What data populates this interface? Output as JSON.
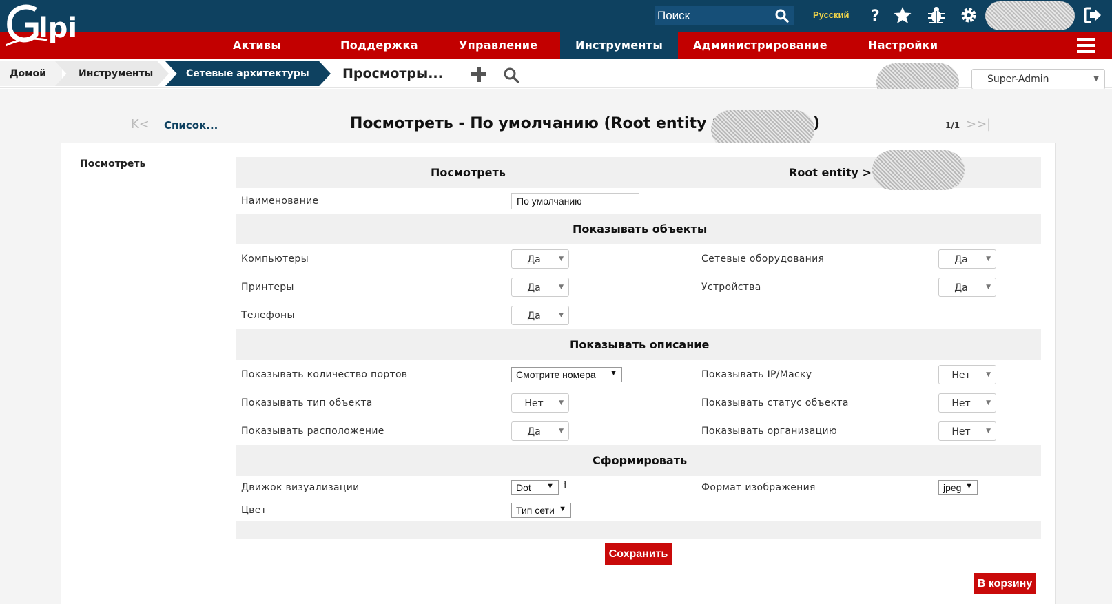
{
  "app": {
    "name": "GLPI"
  },
  "header": {
    "search_placeholder": "Поиск",
    "language": "Русский",
    "icons": [
      "help-icon",
      "star-icon",
      "bug-icon",
      "gear-icon",
      "logout-icon"
    ]
  },
  "menu": {
    "items": [
      "Активы",
      "Поддержка",
      "Управление",
      "Инструменты",
      "Администрирование",
      "Настройки"
    ],
    "active": "Инструменты"
  },
  "breadcrumb": {
    "home": "Домой",
    "tools": "Инструменты",
    "network": "Сетевые архитектуры",
    "views": "Просмотры..."
  },
  "profile": {
    "selected": "Super-Admin"
  },
  "nav": {
    "list_link": "Список...",
    "count": "1/1"
  },
  "page": {
    "title": "Посмотреть - По умолчанию (Root entity > ",
    "title_close": ")",
    "side_tab": "Посмотреть"
  },
  "form": {
    "header": {
      "left": "Посмотреть",
      "right": "Root entity >"
    },
    "name_label": "Наименование",
    "name_value": "По умолчанию",
    "section_objects": "Показывать объекты",
    "computers_label": "Компьютеры",
    "computers_value": "Да",
    "network_equipment_label": "Сетевые оборудования",
    "network_equipment_value": "Да",
    "printers_label": "Принтеры",
    "printers_value": "Да",
    "devices_label": "Устройства",
    "devices_value": "Да",
    "phones_label": "Телефоны",
    "phones_value": "Да",
    "section_description": "Показывать описание",
    "ports_label": "Показывать количество портов",
    "ports_value": "Смотрите номера",
    "ipmask_label": "Показывать IP/Маску",
    "ipmask_value": "Нет",
    "type_label": "Показывать тип объекта",
    "type_value": "Нет",
    "status_label": "Показывать статус объекта",
    "status_value": "Нет",
    "location_label": "Показывать расположение",
    "location_value": "Да",
    "entity_label": "Показывать организацию",
    "entity_value": "Нет",
    "section_generate": "Сформировать",
    "engine_label": "Движок визуализации",
    "engine_value": "Dot",
    "format_label": "Формат изображения",
    "format_value": "jpeg",
    "color_label": "Цвет",
    "color_value": "Тип сети",
    "info_icon": "i",
    "save_label": "Сохранить",
    "trash_label": "В корзину"
  },
  "colors": {
    "header_bg": "#0e4160",
    "menu_bg": "#c20000",
    "button_bg": "#c90a0a",
    "lang": "#f0d44a"
  }
}
